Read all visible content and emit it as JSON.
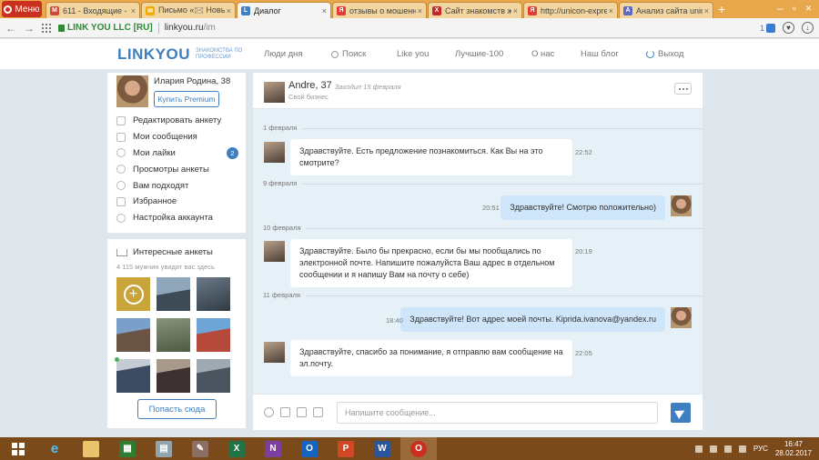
{
  "browser": {
    "menu_label": "Меню",
    "tabs": [
      {
        "title": "611 - Входящие -",
        "fav_color": "#d14836",
        "fav_glyph": "M",
        "active": false
      },
      {
        "title": "Письмо «🖂 Новые",
        "fav_color": "#f2a900",
        "fav_glyph": "✉",
        "active": false
      },
      {
        "title": "Диалог",
        "fav_color": "#3e7fc1",
        "fav_glyph": "L",
        "active": true
      },
      {
        "title": "отзывы о мошенни",
        "fav_color": "#e53935",
        "fav_glyph": "Я",
        "active": false
      },
      {
        "title": "Сайт знакомств жа",
        "fav_color": "#c62828",
        "fav_glyph": "X",
        "active": false
      },
      {
        "title": "http://unicon-expre",
        "fav_color": "#e53935",
        "fav_glyph": "Я",
        "active": false
      },
      {
        "title": "Анализ сайта unico",
        "fav_color": "#5c6bc0",
        "fav_glyph": "A",
        "active": false
      }
    ],
    "secure_label": "LINK YOU LLC [RU]",
    "url_host": "linkyou.ru",
    "url_path": "/im",
    "badge_count": "1"
  },
  "site": {
    "logo": "LINKYOU",
    "tagline": "ЗНАКОМСТВА ПО ПРОФЕССИИ",
    "nav": [
      "Люди дня",
      "Поиск",
      "Like you",
      "Лучшие-100",
      "О нас",
      "Наш блог",
      "Выход"
    ]
  },
  "profile": {
    "name": "Илария Родина, 38",
    "premium_label": "Купить Premium",
    "menu": [
      {
        "label": "Редактировать анкету",
        "icon": "pencil-icon"
      },
      {
        "label": "Мои сообщения",
        "icon": "message-icon"
      },
      {
        "label": "Мои лайки",
        "icon": "heart-icon",
        "count": "2"
      },
      {
        "label": "Просмотры анкеты",
        "icon": "eye-icon"
      },
      {
        "label": "Вам подходят",
        "icon": "users-icon"
      },
      {
        "label": "Избранное",
        "icon": "star-icon"
      },
      {
        "label": "Настройка аккаунта",
        "icon": "gear-icon"
      }
    ]
  },
  "interest": {
    "title": "Интересные анкеты",
    "subtitle": "4 115 мужчин увидят вас здесь",
    "button": "Попасть сюда"
  },
  "chat": {
    "name": "Andre, 37",
    "visited": "Заходил 15 февраля",
    "status": "Свой бизнес",
    "days": [
      "1 февраля",
      "9 февраля",
      "10 февраля",
      "11 февраля"
    ],
    "messages": [
      {
        "dir": "in",
        "text": "Здравствуйте. Есть предложение познакомиться. Как Вы на это смотрите?",
        "time": "22:52"
      },
      {
        "dir": "out",
        "text": "Здравствуйте! Смотрю положительно)",
        "time": "20:51"
      },
      {
        "dir": "in",
        "text": "Здравствуйте. Было бы прекрасно, если бы мы пообщались по электронной почте. Напишите пожалуйста Ваш адрес в отдельном сообщении и я напишу Вам на почту о себе)",
        "time": "20:19"
      },
      {
        "dir": "out",
        "text": "Здравствуйте! Вот адрес моей почты. Kiprida.ivanova@yandex.ru",
        "time": "18:40"
      },
      {
        "dir": "in",
        "text": "Здравствуйте, спасибо за понимание, я отправлю вам сообщение на эл.почту.",
        "time": "22:05"
      }
    ],
    "input_placeholder": "Напишите сообщение..."
  },
  "taskbar": {
    "lang": "РУС",
    "time": "16:47",
    "date": "28.02.2017"
  },
  "colors": {
    "accent": "#3e7fc1",
    "chat_bg": "#e6f0f7",
    "out_bubble": "#cfe5f9",
    "tabbar": "#e9a74c",
    "taskbar": "#7a4a1b"
  }
}
